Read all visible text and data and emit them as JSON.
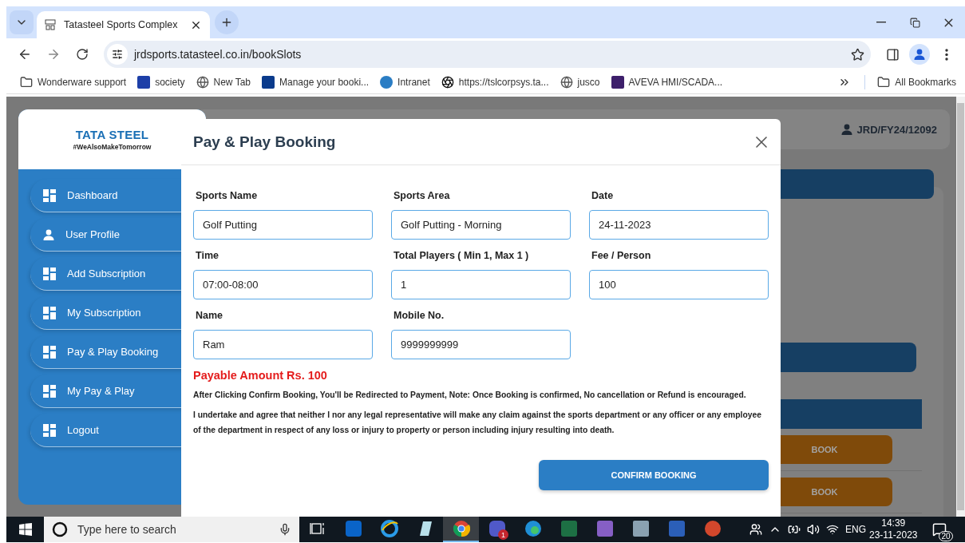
{
  "browser": {
    "tabs": [
      {
        "title": "Tatasteel Sports Complex",
        "selected": true
      }
    ],
    "url": "jrdsports.tatasteel.co.in/bookSlots",
    "bookmarks": [
      {
        "label": "Wonderware support",
        "kind": "folder"
      },
      {
        "label": "society",
        "kind": "logo-blue"
      },
      {
        "label": "New Tab",
        "kind": "globe"
      },
      {
        "label": "Manage your booki...",
        "kind": "logo-navy"
      },
      {
        "label": "Intranet",
        "kind": "logo-tata"
      },
      {
        "label": "https://tslcorpsys.ta...",
        "kind": "aperture"
      },
      {
        "label": "jusco",
        "kind": "globe"
      },
      {
        "label": "AVEVA HMI/SCADA...",
        "kind": "logo-purple"
      }
    ],
    "all_bookmarks": "All Bookmarks"
  },
  "sidebar": {
    "brand": "TATA STEEL",
    "tagline": "#WeAlsoMakeTomorrow",
    "items": [
      {
        "label": "Dashboard",
        "kind": "grid"
      },
      {
        "label": "User Profile",
        "kind": "user"
      },
      {
        "label": "Add Subscription",
        "kind": "grid"
      },
      {
        "label": "My Subscription",
        "kind": "grid"
      },
      {
        "label": "Pay & Play Booking",
        "kind": "grid"
      },
      {
        "label": "My Pay & Play",
        "kind": "grid"
      },
      {
        "label": "Logout",
        "kind": "grid"
      }
    ]
  },
  "header": {
    "user_id": "JRD/FY24/12092"
  },
  "slots": {
    "rows": [
      {
        "action": "BOOK"
      },
      {
        "action": "BOOK"
      }
    ]
  },
  "modal": {
    "title": "Pay & Play Booking",
    "fields": [
      {
        "label": "Sports Name",
        "value": "Golf Putting"
      },
      {
        "label": "Sports Area",
        "value": "Golf Putting - Morning"
      },
      {
        "label": "Date",
        "value": "24-11-2023"
      },
      {
        "label": "Time",
        "value": "07:00-08:00"
      },
      {
        "label": "Total Players ( Min 1, Max 1 )",
        "value": "1"
      },
      {
        "label": "Fee / Person",
        "value": "100"
      },
      {
        "label": "Name",
        "value": "Ram"
      },
      {
        "label": "Mobile No.",
        "value": "9999999999"
      }
    ],
    "payable": "Payable Amount Rs. 100",
    "note": "After Clicking Confirm Booking, You'll be Redirected to Payment, Note: Once Booking is confirmed, No cancellation or Refund is encouraged.",
    "declaration": "I undertake and agree that neither I nor any legal representative will make any claim against the sports department or any officer or any employee of the department in respect of any loss or injury to property or person including injury resulting into death.",
    "confirm": "CONFIRM BOOKING"
  },
  "taskbar": {
    "search_placeholder": "Type here to search",
    "apps": [
      {
        "kind": "taskview",
        "selected": false
      },
      {
        "kind": "outlook",
        "selected": false
      },
      {
        "kind": "ie",
        "selected": false
      },
      {
        "kind": "notes",
        "selected": false
      },
      {
        "kind": "chrome",
        "selected": true
      },
      {
        "kind": "teams",
        "selected": false
      },
      {
        "kind": "edge",
        "selected": false
      },
      {
        "kind": "excel",
        "selected": false
      },
      {
        "kind": "vs",
        "selected": false
      },
      {
        "kind": "calc",
        "selected": false
      },
      {
        "kind": "word",
        "selected": false
      },
      {
        "kind": "ppt",
        "selected": false
      }
    ],
    "teams_badge": "1",
    "language": "ENG",
    "time": "14:39",
    "date": "23-11-2023",
    "notifications": "20"
  }
}
